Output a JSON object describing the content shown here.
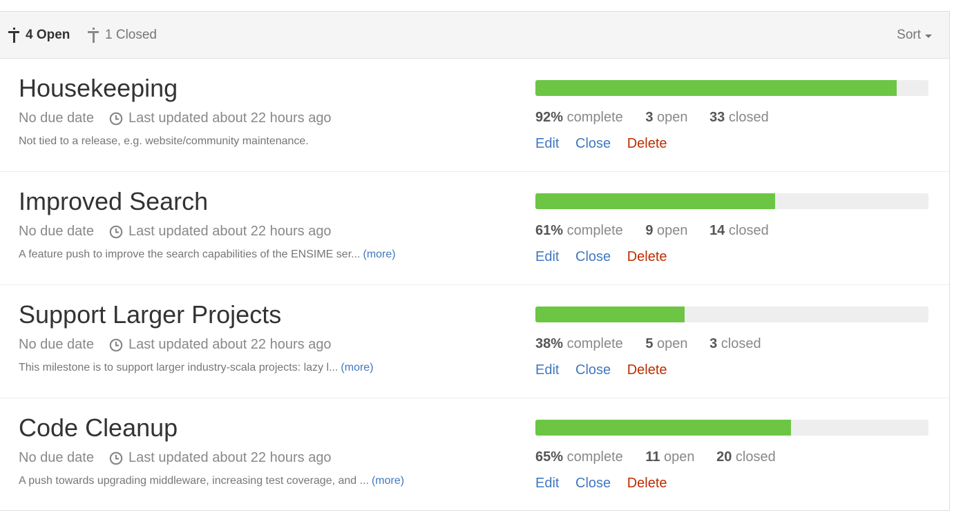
{
  "filters": {
    "open_label": "4 Open",
    "closed_label": "1 Closed",
    "sort_label": "Sort"
  },
  "colors": {
    "progress_fill": "#6cc644",
    "progress_track": "#eeeeee",
    "link": "#4078c0",
    "delete": "#bd2c00"
  },
  "milestones": [
    {
      "title": "Housekeeping",
      "due": "No due date",
      "updated": "Last updated about 22 hours ago",
      "description": "Not tied to a release, e.g. website/community maintenance.",
      "more": "",
      "progress": 0.92,
      "percent": "92%",
      "complete_label": "complete",
      "open_count": "3",
      "open_label": "open",
      "closed_count": "33",
      "closed_label": "closed",
      "edit": "Edit",
      "close": "Close",
      "delete": "Delete"
    },
    {
      "title": "Improved Search",
      "due": "No due date",
      "updated": "Last updated about 22 hours ago",
      "description": "A feature push to improve the search capabilities of the ENSIME ser...",
      "more": "(more)",
      "progress": 0.61,
      "percent": "61%",
      "complete_label": "complete",
      "open_count": "9",
      "open_label": "open",
      "closed_count": "14",
      "closed_label": "closed",
      "edit": "Edit",
      "close": "Close",
      "delete": "Delete"
    },
    {
      "title": "Support Larger Projects",
      "due": "No due date",
      "updated": "Last updated about 22 hours ago",
      "description": "This milestone is to support larger industry-scala projects: lazy l...",
      "more": "(more)",
      "progress": 0.38,
      "percent": "38%",
      "complete_label": "complete",
      "open_count": "5",
      "open_label": "open",
      "closed_count": "3",
      "closed_label": "closed",
      "edit": "Edit",
      "close": "Close",
      "delete": "Delete"
    },
    {
      "title": "Code Cleanup",
      "due": "No due date",
      "updated": "Last updated about 22 hours ago",
      "description": "A push towards upgrading middleware, increasing test coverage, and ...",
      "more": "(more)",
      "progress": 0.65,
      "percent": "65%",
      "complete_label": "complete",
      "open_count": "11",
      "open_label": "open",
      "closed_count": "20",
      "closed_label": "closed",
      "edit": "Edit",
      "close": "Close",
      "delete": "Delete"
    }
  ]
}
